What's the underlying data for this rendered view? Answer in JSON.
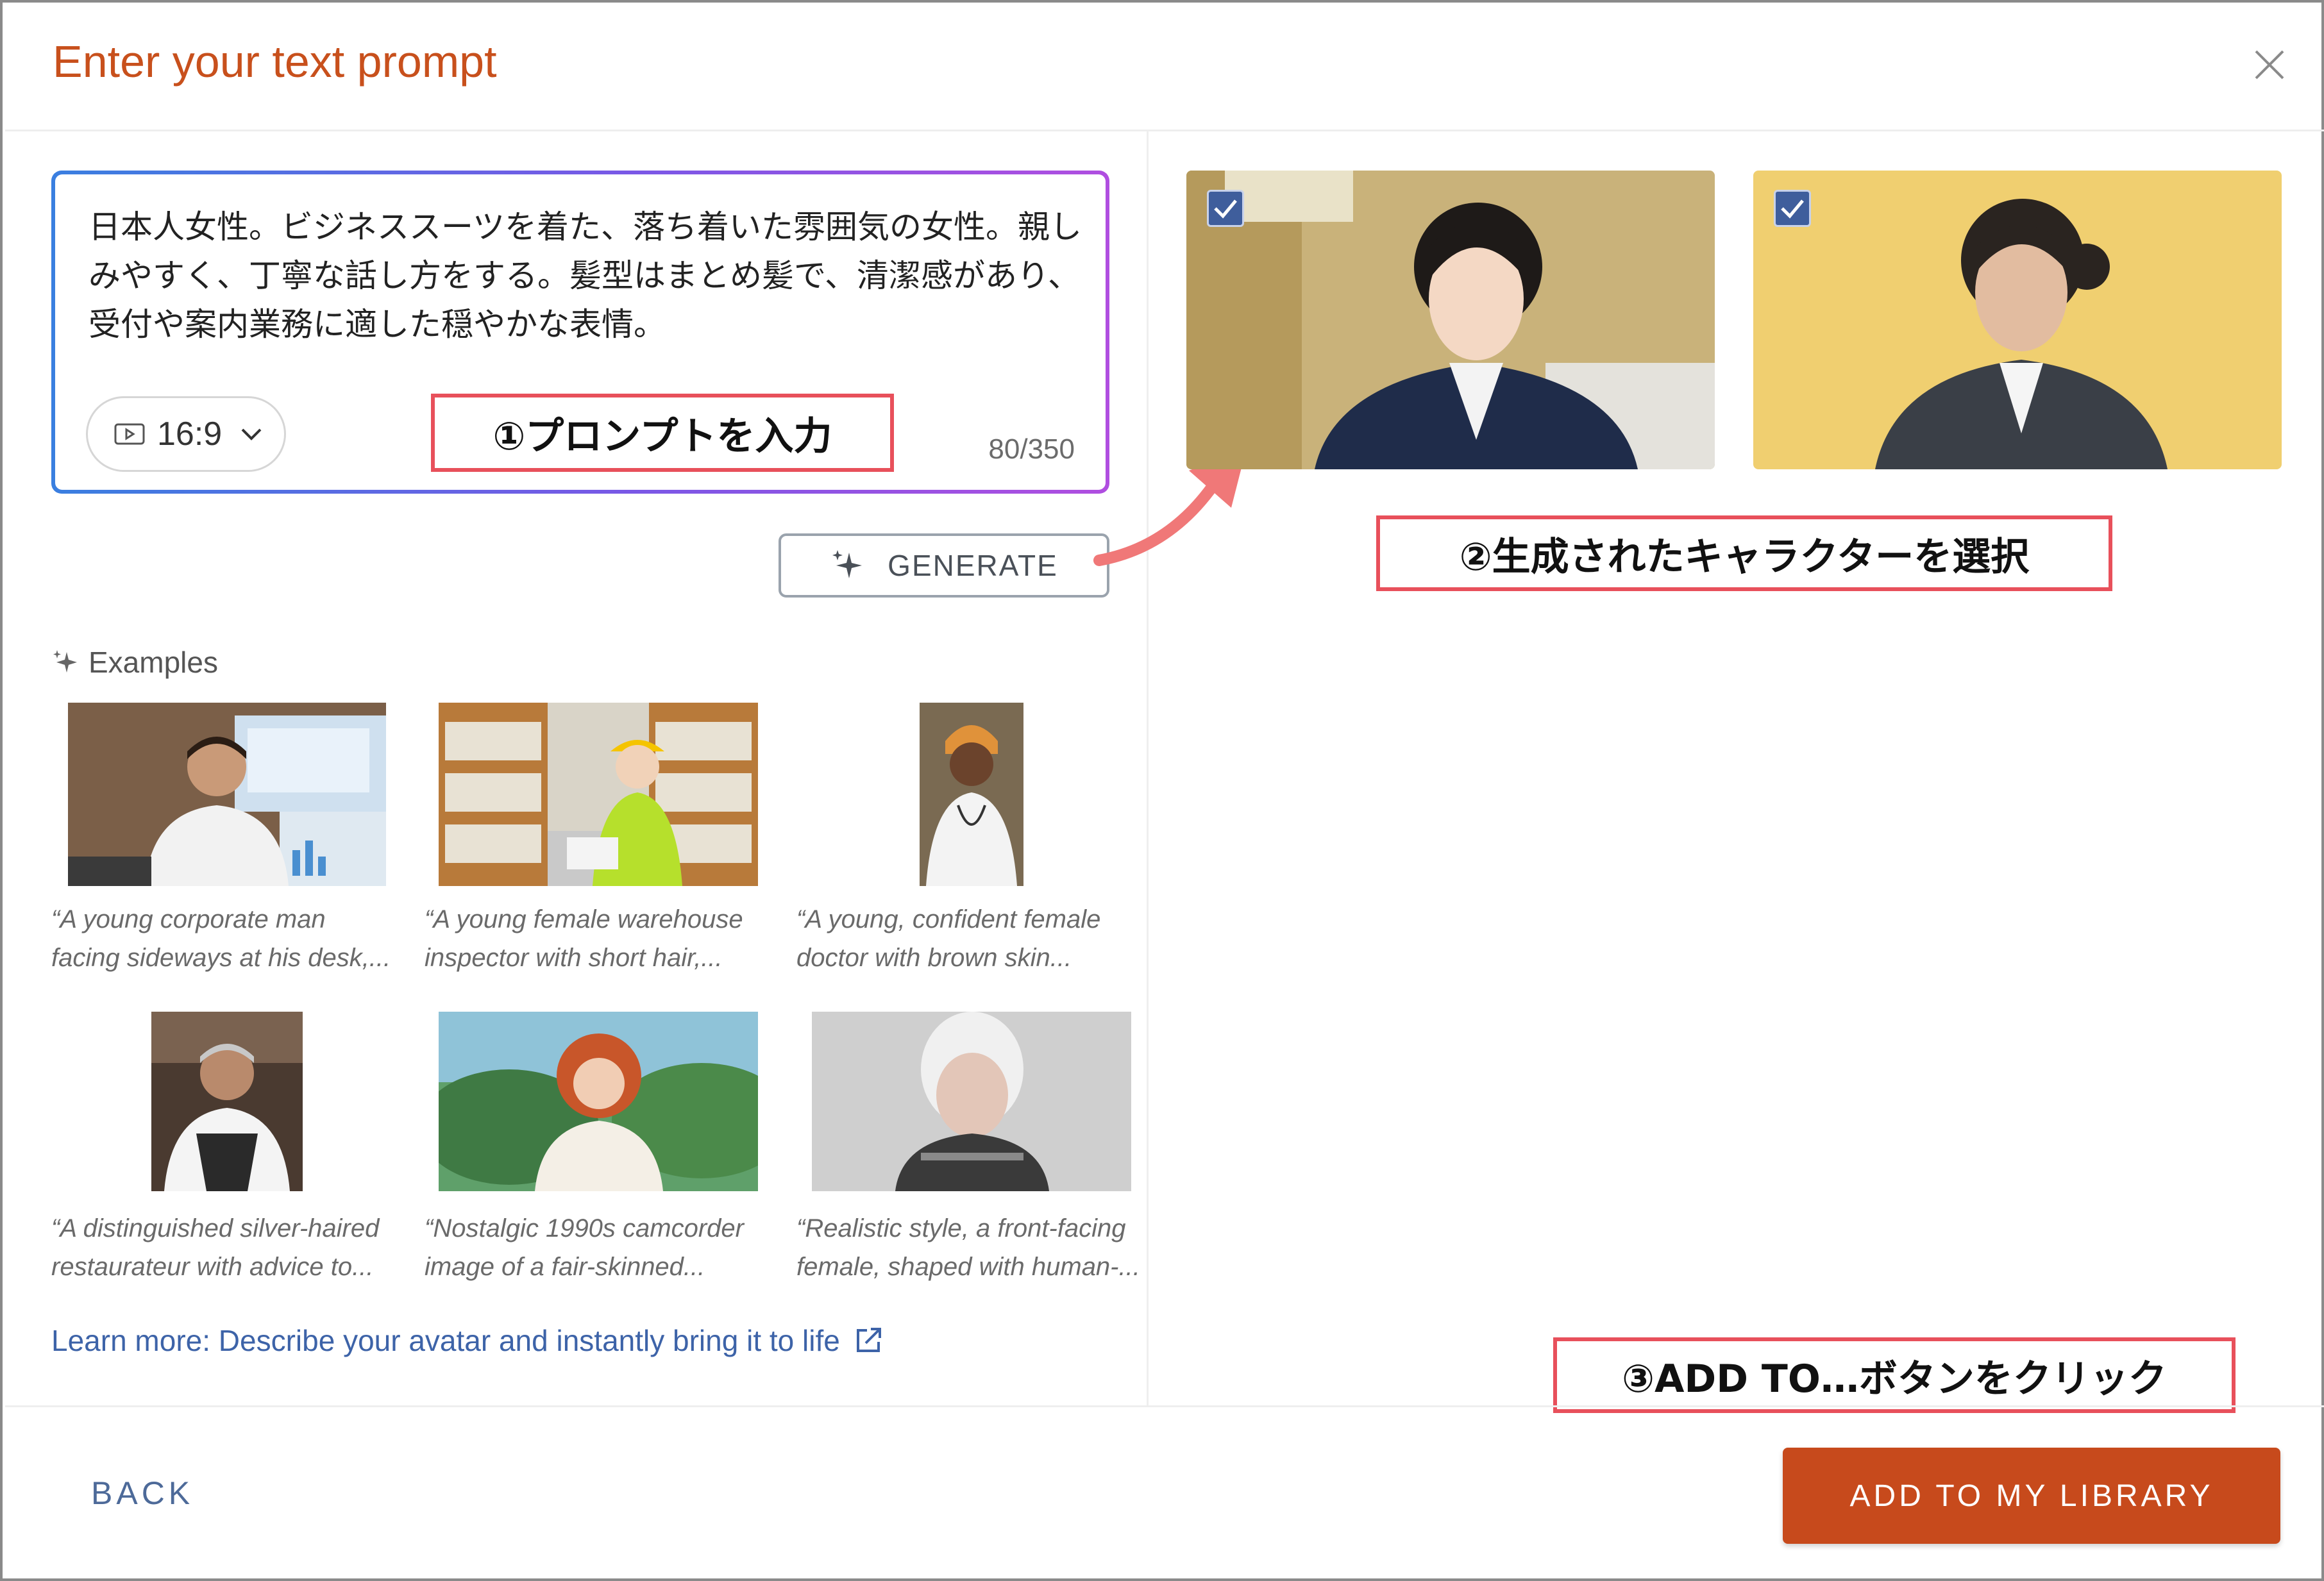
{
  "dialog": {
    "title": "Enter your text prompt",
    "close_icon": "close-icon"
  },
  "prompt": {
    "text": "日本人女性。ビジネススーツを着た、落ち着いた雰囲気の女性。親しみやすく、丁寧な話し方をする。髪型はまとめ髪で、清潔感があり、受付や案内業務に適した穏やかな表情。",
    "aspect_ratio": "16:9",
    "counter": "80/350"
  },
  "generate": {
    "label": "GENERATE"
  },
  "examples": {
    "heading": "Examples",
    "items": [
      {
        "line1": "“A young corporate man",
        "line2": "facing sideways at his desk,..."
      },
      {
        "line1": "“A young female warehouse",
        "line2": "inspector with short hair,..."
      },
      {
        "line1": "“A young, confident female",
        "line2": "doctor with brown skin..."
      },
      {
        "line1": "“A distinguished silver-haired",
        "line2": "restaurateur with advice to..."
      },
      {
        "line1": "“Nostalgic 1990s camcorder",
        "line2": "image of a fair-skinned..."
      },
      {
        "line1": "“Realistic style, a front-facing",
        "line2": "female, shaped with human-..."
      }
    ]
  },
  "learn_more": "Learn more: Describe your avatar and instantly bring it to life",
  "generated": {
    "selected": [
      true,
      true
    ]
  },
  "annotations": {
    "step1": "①プロンプトを入力",
    "step2": "②生成されたキャラクターを選択",
    "step3": "③ADD TO…ボタンをクリック"
  },
  "footer": {
    "back_label": "BACK",
    "add_label": "ADD TO MY LIBRARY"
  },
  "colors": {
    "accent": "#c74a1c",
    "title": "#c8501c",
    "link": "#3d63a8",
    "annotation": "#e8505b"
  }
}
